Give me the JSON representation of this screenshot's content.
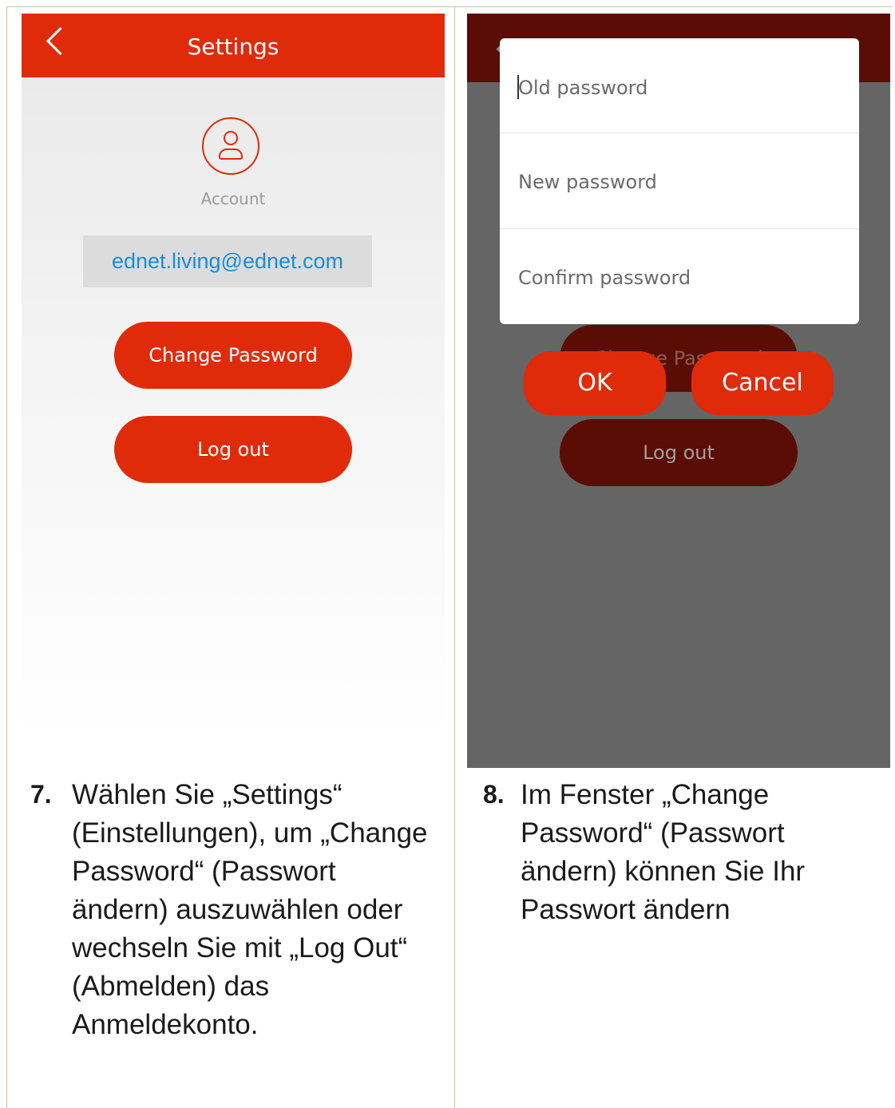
{
  "left_screen": {
    "title": "Settings",
    "account_label": "Account",
    "email": "ednet.living@ednet.com",
    "change_password": "Change Password",
    "log_out": "Log out"
  },
  "right_screen": {
    "old_password": "Old password",
    "new_password": "New password",
    "confirm_password": "Confirm password",
    "ok": "OK",
    "cancel": "Cancel",
    "behind_change_password": "Change Password",
    "behind_log_out": "Log out"
  },
  "steps": [
    {
      "number": "7.",
      "text": "Wählen Sie „Settings“ (Einstellungen), um „Change Password“ (Passwort ändern) auszuwählen oder wechseln Sie mit „Log Out“ (Abmelden) das Anmeldekonto."
    },
    {
      "number": "8.",
      "text": "Im Fenster „Change Password“ (Passwort ändern) können Sie Ihr Passwort ändern"
    }
  ],
  "colors": {
    "accent_red": "#e02b0a",
    "dimmed_red": "#5a0d04",
    "email_blue": "#1a8cd8"
  }
}
